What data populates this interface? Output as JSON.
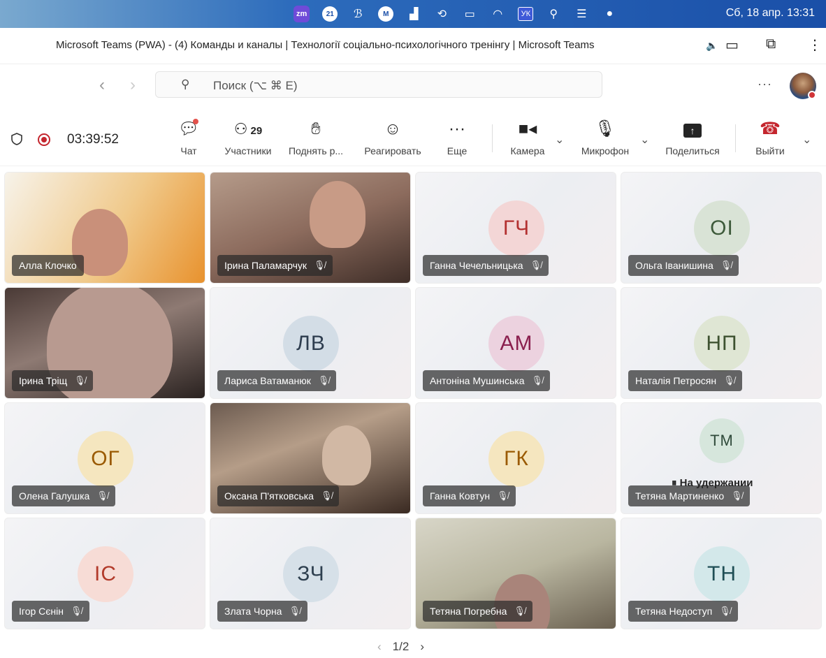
{
  "menubar": {
    "icons": [
      "zm",
      "21",
      "scribble-icon",
      "M",
      "chart-icon",
      "history-icon",
      "battery-icon",
      "wifi-icon",
      "УК",
      "search-icon",
      "control-center-icon",
      "siri-icon"
    ],
    "zm_label": "zm",
    "badge_21": "21",
    "m_label": "M",
    "yk_label": "УК",
    "clock": "Сб, 18 апр.  13:31"
  },
  "window": {
    "title": "Microsoft Teams (PWA) - (4) Команды и каналы | Технології соціально-психологічного тренінгу | Microsoft Teams"
  },
  "nav": {
    "search_placeholder": "Поиск (⌥ ⌘ E)",
    "more": "···"
  },
  "meeting": {
    "timer": "03:39:52",
    "controls": {
      "chat": "Чат",
      "participants": "Участники",
      "participants_count": "29",
      "raise_hand": "Поднять р...",
      "react": "Реагировать",
      "more": "Еще",
      "camera": "Камера",
      "mic": "Микрофон",
      "share": "Поделиться",
      "leave": "Выйти"
    }
  },
  "tiles": [
    {
      "name": "Алла Клочко",
      "type": "video",
      "muted": false
    },
    {
      "name": "Ірина Паламарчук",
      "type": "video",
      "muted": true
    },
    {
      "name": "Ганна Чечельницька",
      "type": "avatar",
      "initials": "ГЧ",
      "color": "#f3d6d6",
      "text": "#b33030",
      "muted": true
    },
    {
      "name": "Ольга Іванишина",
      "type": "avatar",
      "initials": "OI",
      "color": "#d9e3d6",
      "text": "#3d5a3a",
      "muted": true
    },
    {
      "name": "Ірина Тріщ",
      "type": "video",
      "muted": true
    },
    {
      "name": "Лариса Ватаманюк",
      "type": "avatar",
      "initials": "ЛВ",
      "color": "#d3dde6",
      "text": "#2e3d4f",
      "muted": true
    },
    {
      "name": "Антоніна Мушинська",
      "type": "avatar",
      "initials": "АМ",
      "color": "#ecd2df",
      "text": "#8a1f4e",
      "muted": true
    },
    {
      "name": "Наталія Петросян",
      "type": "avatar",
      "initials": "НП",
      "color": "#dfe6d4",
      "text": "#3e5230",
      "muted": true
    },
    {
      "name": "Олена Галушка",
      "type": "avatar",
      "initials": "ОГ",
      "color": "#f5e6bf",
      "text": "#9a5a00",
      "muted": true
    },
    {
      "name": "Оксана П'ятковська",
      "type": "video",
      "muted": true
    },
    {
      "name": "Ганна Ковтун",
      "type": "avatar",
      "initials": "ГК",
      "color": "#f5e6bf",
      "text": "#9a5a00",
      "muted": true
    },
    {
      "name": "Тетяна Мартиненко",
      "type": "avatar",
      "initials": "ТМ",
      "color": "#d6e6dc",
      "text": "#2f4a3a",
      "muted": true,
      "hold": "На удержании"
    },
    {
      "name": "Ігор Сєнін",
      "type": "avatar",
      "initials": "ІС",
      "color": "#f7dcd6",
      "text": "#b23a2a",
      "muted": true
    },
    {
      "name": "Злата Чорна",
      "type": "avatar",
      "initials": "ЗЧ",
      "color": "#d6e0e8",
      "text": "#2e3f4f",
      "muted": true
    },
    {
      "name": "Тетяна Погребна",
      "type": "video",
      "muted": true
    },
    {
      "name": "Тетяна Недоступ",
      "type": "avatar",
      "initials": "ТН",
      "color": "#d3e8ea",
      "text": "#1f4e55",
      "muted": true
    }
  ],
  "pager": {
    "text": "1/2",
    "prev": "‹",
    "next": "›"
  }
}
